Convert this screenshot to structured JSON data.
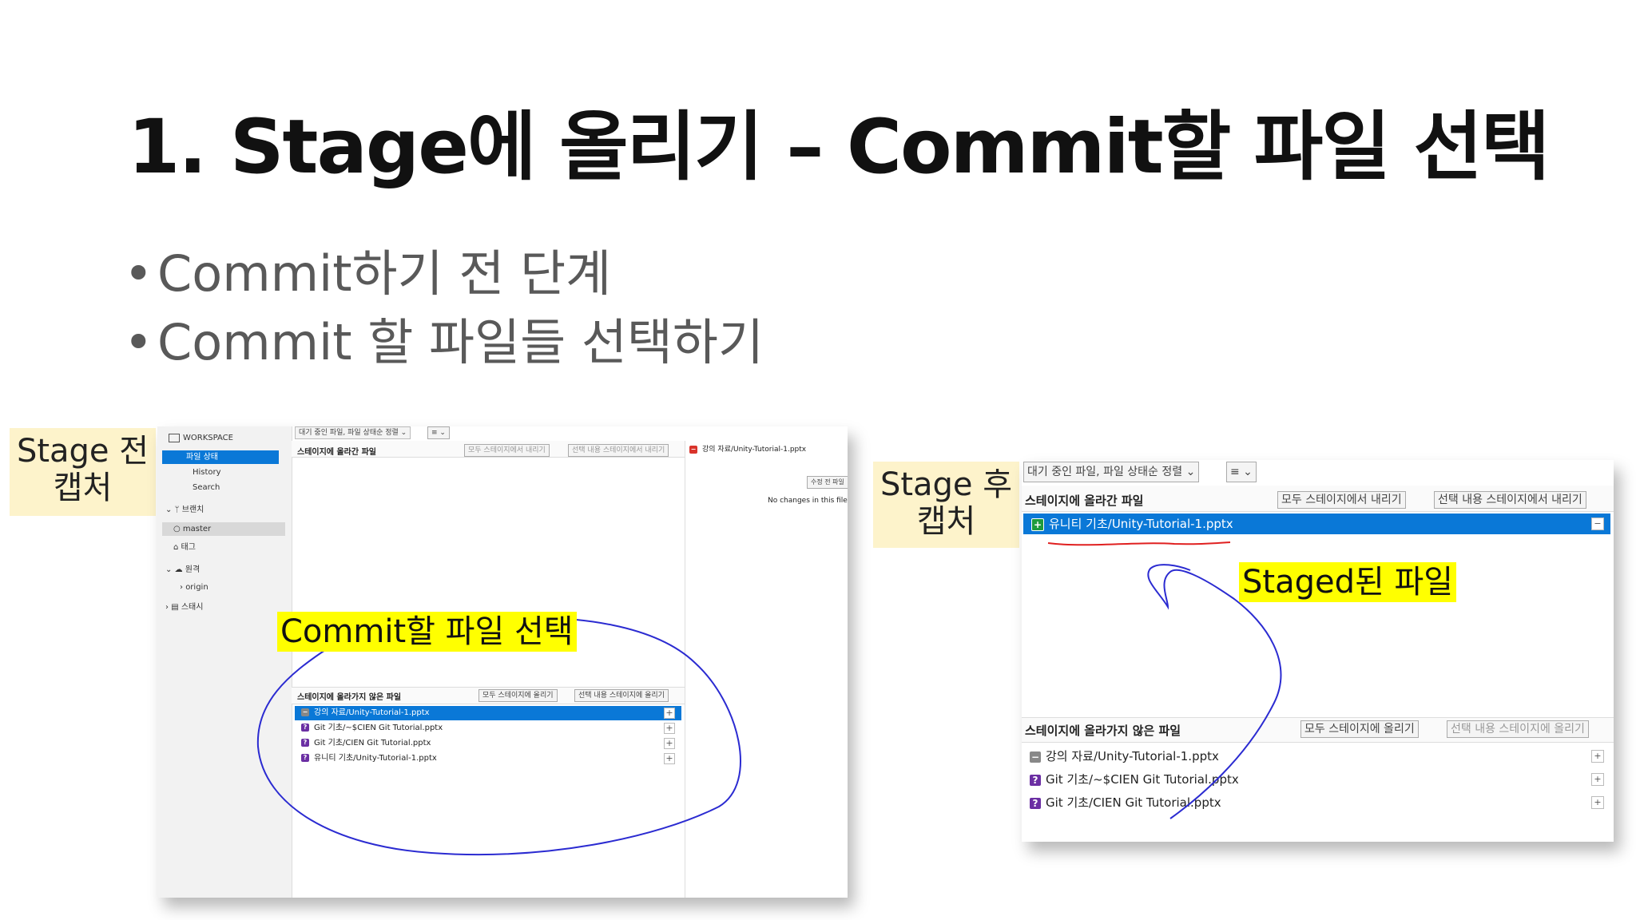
{
  "slide": {
    "title": "1. Stage에 올리기 – Commit할 파일 선택",
    "bullets": [
      "Commit하기 전 단계",
      "Commit 할 파일들 선택하기"
    ],
    "bullet_glyph": "•"
  },
  "notes": {
    "before": "Stage 전\n캡처",
    "after": "Stage 후\n캡처",
    "commit_select": "Commit할 파일 선택",
    "staged_files": "Staged된 파일"
  },
  "before_shot": {
    "sidebar": {
      "workspace": "WORKSPACE",
      "items": [
        "파일 상태",
        "History",
        "Search"
      ],
      "branches": "브랜치",
      "master": "master",
      "tags": "태그",
      "remotes": "원격",
      "origin": "origin",
      "stash": "스태시"
    },
    "sort_dropdown": "대기 중인 파일, 파일 상태순 정렬",
    "list_icon": "≡",
    "staged_header": "스테이지에 올라간 파일",
    "unstage_all": "모두 스테이지에서 내리기",
    "unstage_selected": "선택 내용 스테이지에서 내리기",
    "diff_file": "강의 자료/Unity-Tutorial-1.pptx",
    "diff_button": "수정 전 파일",
    "no_changes": "No changes in this file",
    "unstaged_header": "스테이지에 올라가지 않은 파일",
    "stage_all": "모두 스테이지에 올리기",
    "stage_selected": "선택 내용 스테이지에 올리기",
    "unstaged_files": [
      "강의 자료/Unity-Tutorial-1.pptx",
      "Git 기초/~$CIEN Git Tutorial.pptx",
      "Git 기초/CIEN Git Tutorial.pptx",
      "유니티 기초/Unity-Tutorial-1.pptx"
    ]
  },
  "after_shot": {
    "sort_dropdown": "대기 중인 파일, 파일 상태순 정렬",
    "list_icon": "≡",
    "staged_header": "스테이지에 올라간 파일",
    "unstage_all": "모두 스테이지에서 내리기",
    "unstage_selected": "선택 내용 스테이지에서 내리기",
    "staged_files": [
      "유니티 기초/Unity-Tutorial-1.pptx"
    ],
    "unstaged_header": "스테이지에 올라가지 않은 파일",
    "stage_all": "모두 스테이지에 올리기",
    "stage_selected": "선택 내용 스테이지에 올리기",
    "unstaged_files": [
      "강의 자료/Unity-Tutorial-1.pptx",
      "Git 기초/~$CIEN Git Tutorial.pptx",
      "Git 기초/CIEN Git Tutorial.pptx"
    ]
  },
  "colors": {
    "selection": "#0a78d7",
    "highlight": "#ffff00",
    "sticky": "#fdf3cb",
    "ink": "#2b2bd1",
    "underline": "#e02020"
  }
}
